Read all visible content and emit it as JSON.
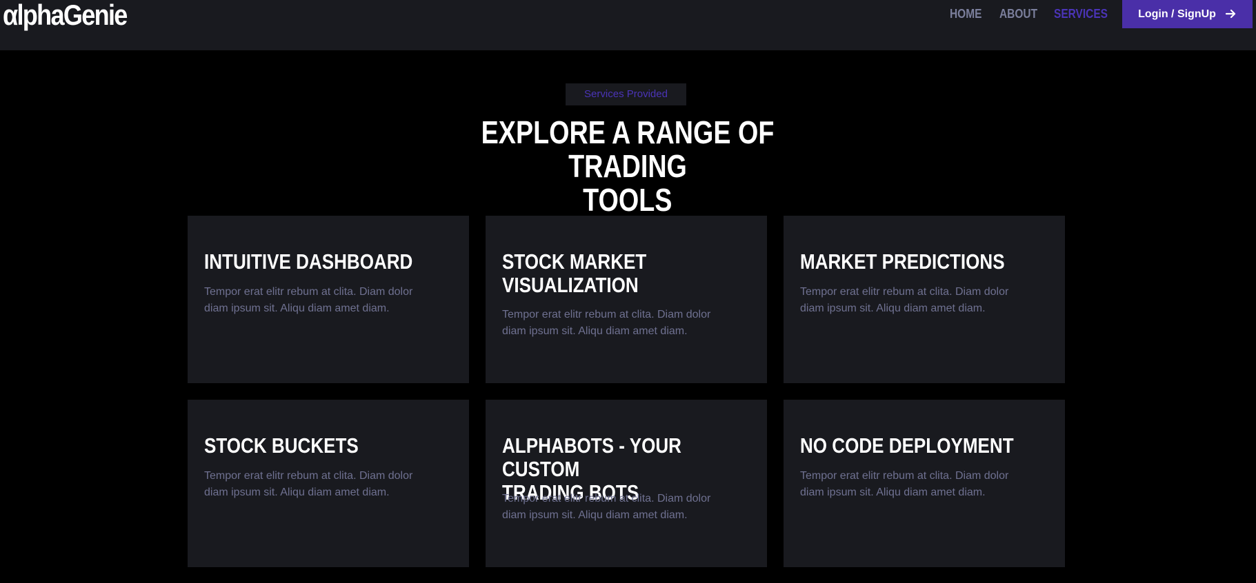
{
  "navbar": {
    "logo": "αlphaGenie",
    "links": [
      {
        "label": "HOME",
        "active": false
      },
      {
        "label": "ABOUT",
        "active": false
      },
      {
        "label": "SERVICES",
        "active": true
      }
    ],
    "login_label": "Login / SignUp",
    "login_icon": "arrow-right-icon"
  },
  "section": {
    "badge": "Services Provided",
    "headline_line1": "EXPLORE A RANGE OF TRADING",
    "headline_line2": "TOOLS"
  },
  "cards": [
    {
      "title": "INTUITIVE DASHBOARD",
      "text": "Tempor erat elitr rebum at clita. Diam dolor diam ipsum sit. Aliqu diam amet diam."
    },
    {
      "title_line1": "STOCK MARKET",
      "title_line2": "VISUALIZATION",
      "text": "Tempor erat elitr rebum at clita. Diam dolor diam ipsum sit. Aliqu diam amet diam."
    },
    {
      "title": "MARKET PREDICTIONS",
      "text": "Tempor erat elitr rebum at clita. Diam dolor diam ipsum sit. Aliqu diam amet diam."
    },
    {
      "title": "STOCK BUCKETS",
      "text": "Tempor erat elitr rebum at clita. Diam dolor diam ipsum sit. Aliqu diam amet diam."
    },
    {
      "title_line1": "ALPHABOTS - YOUR CUSTOM",
      "title_line2": "TRADING BOTS",
      "text": "Tempor erat elitr rebum at clita. Diam dolor diam ipsum sit. Aliqu diam amet diam."
    },
    {
      "title": "NO CODE DEPLOYMENT",
      "text": "Tempor erat elitr rebum at clita. Diam dolor diam ipsum sit. Aliqu diam amet diam."
    }
  ],
  "colors": {
    "background": "#000000",
    "surface": "#191a1f",
    "accent": "#4a2fa8",
    "muted_text": "#6f7191",
    "nav_text": "#7b7f9c"
  }
}
